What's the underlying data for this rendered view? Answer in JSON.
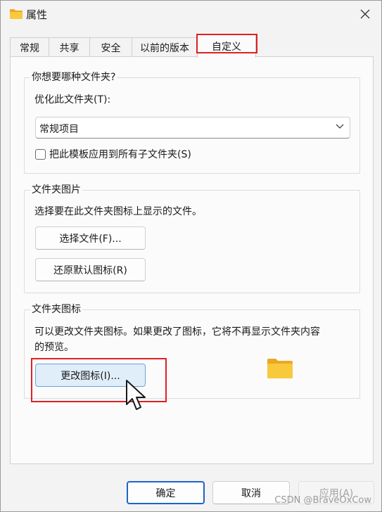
{
  "window": {
    "title": "属性",
    "close_glyph": "✕",
    "icons": {
      "title": "folder-icon",
      "close": "close-icon"
    }
  },
  "tabs": [
    {
      "label": "常规"
    },
    {
      "label": "共享"
    },
    {
      "label": "安全"
    },
    {
      "label": "以前的版本"
    },
    {
      "label": "自定义",
      "active": true
    }
  ],
  "optimize_group": {
    "title": "你想要哪种文件夹?",
    "optimize_label": "优化此文件夹(T):",
    "select_value": "常规项目",
    "checkbox_label": "把此模板应用到所有子文件夹(S)",
    "checkbox_checked": false
  },
  "picture_group": {
    "title": "文件夹图片",
    "description": "选择要在此文件夹图标上显示的文件。",
    "choose_file_button": "选择文件(F)...",
    "restore_default_button": "还原默认图标(R)"
  },
  "icon_group": {
    "title": "文件夹图标",
    "description_line1": "可以更改文件夹图标。如果更改了图标，它将不再显示文件夹内容",
    "description_line2": "的预览。",
    "change_icon_button": "更改图标(I)..."
  },
  "footer": {
    "ok_button": "确定",
    "cancel_button": "取消",
    "apply_button": "应用(A)"
  },
  "watermark": "CSDN @BraveOxCow",
  "colors": {
    "accent": "#1c64c8",
    "highlight_red": "#e02020",
    "folder_yellow": "#f8c93a",
    "hover_blue": "#e0eef9"
  }
}
